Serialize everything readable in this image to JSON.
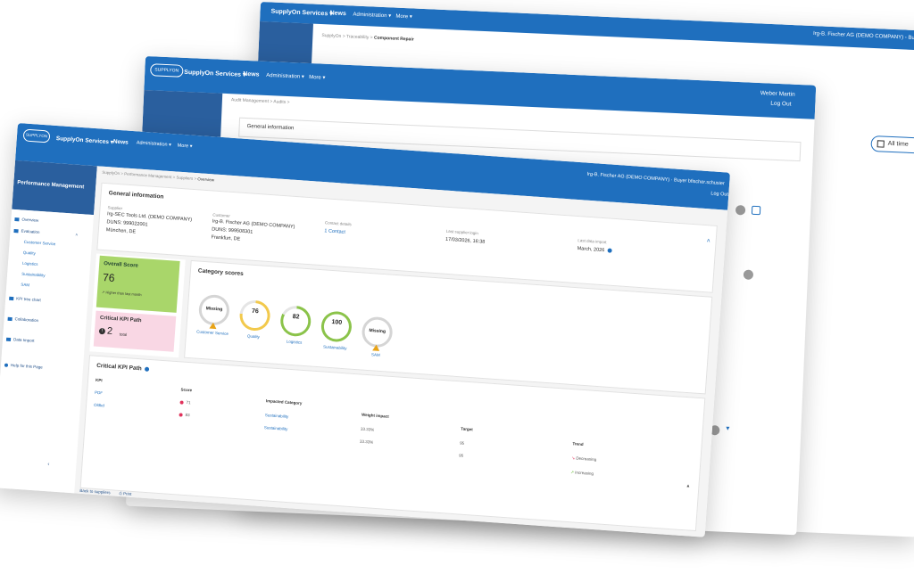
{
  "back_window": {
    "nav": {
      "brand": "SupplyOn Services ▾",
      "news": "News",
      "admin": "Administration ▾",
      "more": "More ▾"
    },
    "user": "Irg-B. Fischer AG (DEMO COMPANY) - Buyer",
    "breadcrumb": [
      "SupplyOn",
      "Traceability",
      "Component Repair"
    ],
    "filter_label": "All time"
  },
  "middle_window": {
    "nav": {
      "brand": "SupplyOn Services ▾",
      "news": "News",
      "admin": "Administration ▾",
      "more": "More ▾"
    },
    "logo": "SUPPLYON",
    "user_name": "Weber Martin",
    "logout": "Log Out",
    "breadcrumb": [
      "Audit Management",
      "Audits"
    ],
    "section_title": "General information"
  },
  "front_window": {
    "logo": "SUPPLYON",
    "nav": {
      "brand": "SupplyOn Services ▾",
      "news": "News",
      "admin": "Administration ▾",
      "more": "More ▾"
    },
    "user": "Irg-B. Fischer AG (DEMO COMPANY) · Buyer bfischer.schusier",
    "logout": "Log Out",
    "sidebar": {
      "title": "Performance Management",
      "items": [
        "Overview",
        "Evaluation",
        "Customer Service",
        "Quality",
        "Logistics",
        "Sustainability",
        "SAM",
        "KPI tree chart",
        "Collaboration",
        "Data Import",
        "Help for this Page"
      ]
    },
    "breadcrumb": [
      "SupplyOn",
      "Performance Management",
      "Suppliers",
      "Overview"
    ],
    "general": {
      "title": "General information",
      "supplier_label": "Supplier",
      "supplier_name": "Irg-SEC Tools Ltd. (DEMO COMPANY)",
      "supplier_duns": "DUNS: 999022001",
      "supplier_city": "München, DE",
      "customer_label": "Customer",
      "customer_name": "Irg-B. Fischer AG (DEMO COMPANY)",
      "customer_duns": "DUNS: 999508301",
      "customer_city": "Frankfurt, DE",
      "contact_label": "Contact details",
      "contact_link": "1 Contact",
      "login_label": "Last supplier login",
      "login_value": "17/03/2026, 16:38",
      "import_label": "Last data import",
      "import_value": "March, 2026"
    },
    "overall": {
      "title": "Overall Score",
      "value": "76",
      "note": "↗ Higher than last month"
    },
    "critical": {
      "title": "Critical KPI Path",
      "value": "2",
      "suffix": "total"
    },
    "category": {
      "title": "Category scores",
      "gauges": [
        {
          "name": "Customer Service",
          "value": "Missing",
          "fill": 0,
          "color": "#d5d5d5"
        },
        {
          "name": "Quality",
          "value": "76",
          "fill": 0.76,
          "color": "#f2c94c"
        },
        {
          "name": "Logistics",
          "value": "82",
          "fill": 0.82,
          "color": "#8bc34a"
        },
        {
          "name": "Sustainability",
          "value": "100",
          "fill": 1.0,
          "color": "#8bc34a"
        },
        {
          "name": "SAM",
          "value": "Missing",
          "fill": 0,
          "color": "#d5d5d5"
        }
      ]
    },
    "kpi_table": {
      "title": "Critical KPI Path",
      "headers": [
        "KPI",
        "Score",
        "Impacted Category",
        "Weight impact",
        "Target",
        "Trend"
      ],
      "rows": [
        {
          "kpi": "PDF",
          "score": "71",
          "category": "Sustainability",
          "weight": "33.33%",
          "target": "95",
          "trend": "Decreasing"
        },
        {
          "kpi": "Oldkd",
          "score": "83",
          "category": "Sustainability",
          "weight": "33.33%",
          "target": "95",
          "trend": "Increasing"
        }
      ]
    },
    "footer": {
      "back": "Back to suppliers",
      "print": "Print"
    }
  }
}
